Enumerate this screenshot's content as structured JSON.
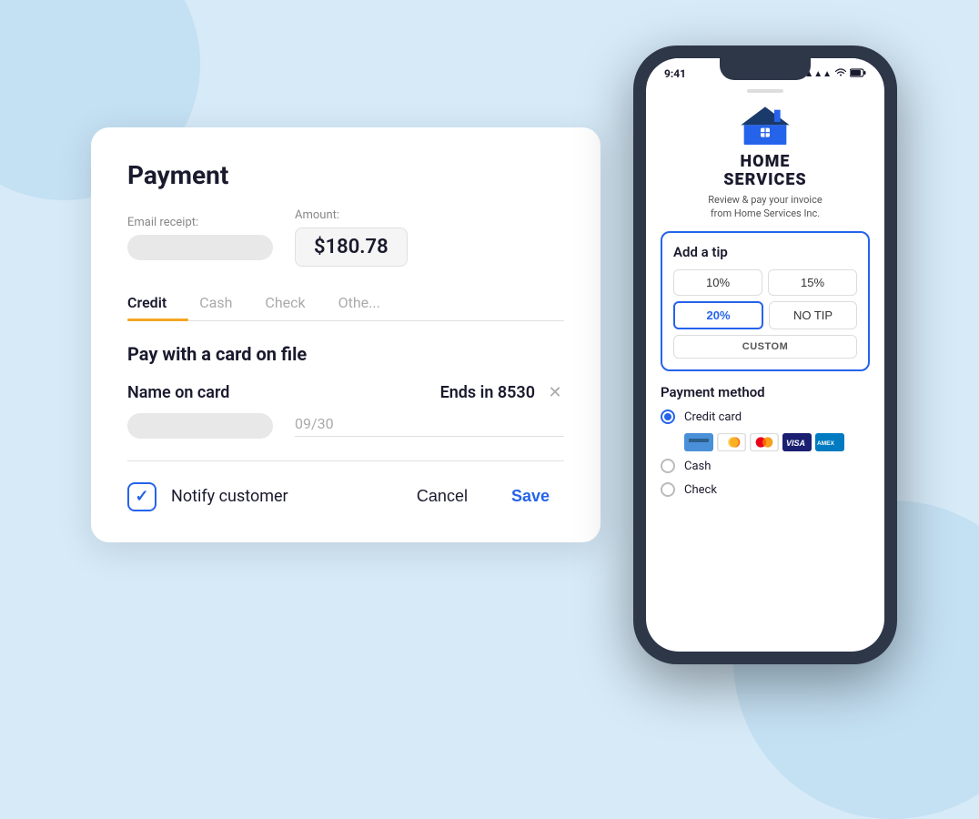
{
  "background": {
    "color": "#d6eaf8"
  },
  "payment_card": {
    "title": "Payment",
    "email_label": "Email receipt:",
    "amount_label": "Amount:",
    "amount_value": "$180.78",
    "tabs": [
      {
        "label": "Credit",
        "active": true
      },
      {
        "label": "Cash",
        "active": false
      },
      {
        "label": "Check",
        "active": false
      },
      {
        "label": "Othe...",
        "active": false
      }
    ],
    "section_title": "Pay with a card on file",
    "card_name_label": "Name on card",
    "card_ends_label": "Ends in 8530",
    "card_expiry": "09/30",
    "notify_label": "Notify customer",
    "cancel_label": "Cancel",
    "save_label": "Save"
  },
  "phone": {
    "status_bar": {
      "time": "9:41",
      "signal": "▲▲▲",
      "wifi": "wifi",
      "battery": "🔋"
    },
    "logo": {
      "company_line1": "HOME",
      "company_line2": "SERVICES",
      "subtitle": "Review & pay your invoice\nfrom Home Services Inc."
    },
    "tip_section": {
      "title": "Add a tip",
      "options": [
        {
          "label": "10%",
          "active": false
        },
        {
          "label": "15%",
          "active": false
        },
        {
          "label": "20%",
          "active": true
        },
        {
          "label": "NO TIP",
          "active": false
        }
      ],
      "custom_label": "CUSTOM"
    },
    "payment_method": {
      "title": "Payment method",
      "options": [
        {
          "label": "Credit card",
          "selected": true
        },
        {
          "label": "Cash",
          "selected": false
        },
        {
          "label": "Check",
          "selected": false
        }
      ]
    }
  }
}
